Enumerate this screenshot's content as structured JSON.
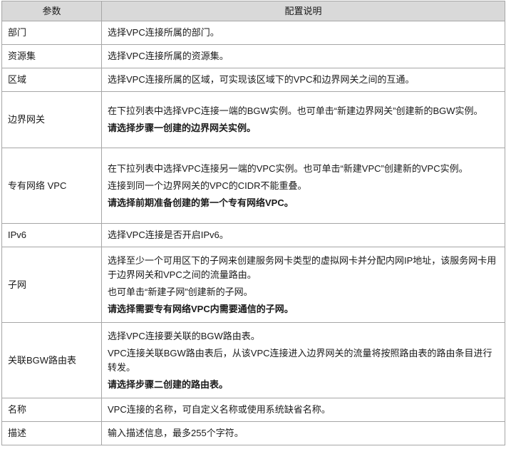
{
  "header": {
    "param": "参数",
    "desc": "配置说明"
  },
  "rows": [
    {
      "param": "部门",
      "height": 33,
      "lines": [
        {
          "text": "选择VPC连接所属的部门。",
          "bold": false
        }
      ]
    },
    {
      "param": "资源集",
      "height": 33,
      "lines": [
        {
          "text": "选择VPC连接所属的资源集。",
          "bold": false
        }
      ]
    },
    {
      "param": "区域",
      "height": 33,
      "lines": [
        {
          "text": "选择VPC连接所属的区域，可实现该区域下的VPC和边界网关之间的互通。",
          "bold": false
        }
      ]
    },
    {
      "param": "边界网关",
      "height": 79,
      "lines": [
        {
          "text": "在下拉列表中选择VPC连接一端的BGW实例。也可单击“新建边界网关”创建新的BGW实例。",
          "bold": false
        },
        {
          "text": "请选择步骤一创建的边界网关实例。",
          "bold": true
        }
      ]
    },
    {
      "param": "专有网络 VPC",
      "height": 106,
      "lines": [
        {
          "text": "在下拉列表中选择VPC连接另一端的VPC实例。也可单击“新建VPC”创建新的VPC实例。",
          "bold": false
        },
        {
          "text": "连接到同一个边界网关的VPC的CIDR不能重叠。",
          "bold": false
        },
        {
          "text": "请选择前期准备创建的第一个专有网络VPC。",
          "bold": true
        }
      ]
    },
    {
      "param": "IPv6",
      "height": 33,
      "lines": [
        {
          "text": "选择VPC连接是否开启IPv6。",
          "bold": false
        }
      ]
    },
    {
      "param": "子网",
      "height": 106,
      "lines": [
        {
          "text": "选择至少一个可用区下的子网来创建服务网卡类型的虚拟网卡并分配内网IP地址，该服务网卡用于边界网关和VPC之间的流量路由。",
          "bold": false
        },
        {
          "text": "也可单击“新建子网”创建新的子网。",
          "bold": false
        },
        {
          "text": "请选择需要专有网络VPC内需要通信的子网。",
          "bold": true
        }
      ]
    },
    {
      "param": "关联BGW路由表",
      "height": 106,
      "lines": [
        {
          "text": "选择VPC连接要关联的BGW路由表。",
          "bold": false
        },
        {
          "text": "VPC连接关联BGW路由表后，从该VPC连接进入边界网关的流量将按照路由表的路由条目进行转发。",
          "bold": false
        },
        {
          "text": "请选择步骤二创建的路由表。",
          "bold": true
        }
      ]
    },
    {
      "param": "名称",
      "height": 33,
      "lines": [
        {
          "text": "VPC连接的名称，可自定义名称或使用系统缺省名称。",
          "bold": false
        }
      ]
    },
    {
      "param": "描述",
      "height": 33,
      "lines": [
        {
          "text": "输入描述信息，最多255个字符。",
          "bold": false
        }
      ]
    }
  ]
}
